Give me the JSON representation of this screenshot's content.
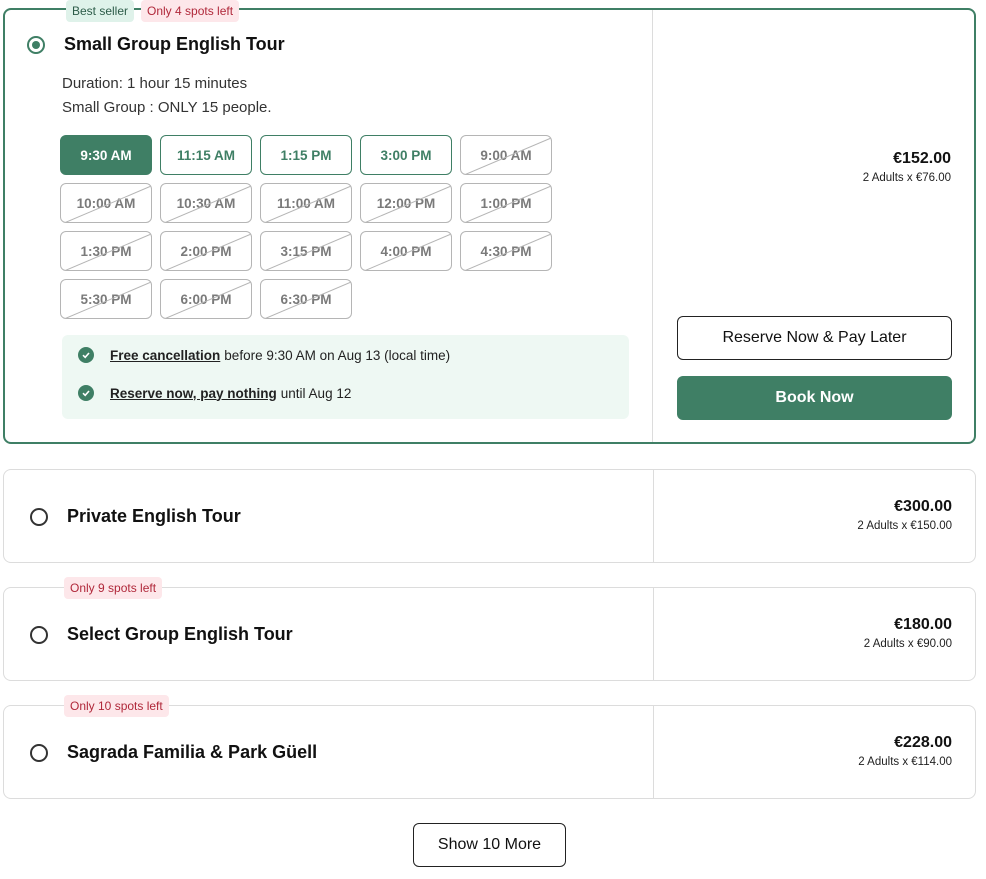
{
  "options": [
    {
      "badges": [
        "Best seller",
        "Only 4 spots left"
      ],
      "title": "Small Group English Tour",
      "duration": "Duration: 1 hour 15 minutes",
      "group": "Small Group : ONLY 15 people.",
      "selected": true,
      "slots": [
        {
          "time": "9:30 AM",
          "state": "selected"
        },
        {
          "time": "11:15 AM",
          "state": "available"
        },
        {
          "time": "1:15 PM",
          "state": "available"
        },
        {
          "time": "3:00 PM",
          "state": "available"
        },
        {
          "time": "9:00 AM",
          "state": "unavailable"
        },
        {
          "time": "10:00 AM",
          "state": "unavailable"
        },
        {
          "time": "10:30 AM",
          "state": "unavailable"
        },
        {
          "time": "11:00 AM",
          "state": "unavailable"
        },
        {
          "time": "12:00 PM",
          "state": "unavailable"
        },
        {
          "time": "1:00 PM",
          "state": "unavailable"
        },
        {
          "time": "1:30 PM",
          "state": "unavailable"
        },
        {
          "time": "2:00 PM",
          "state": "unavailable"
        },
        {
          "time": "3:15 PM",
          "state": "unavailable"
        },
        {
          "time": "4:00 PM",
          "state": "unavailable"
        },
        {
          "time": "4:30 PM",
          "state": "unavailable"
        },
        {
          "time": "5:30 PM",
          "state": "unavailable"
        },
        {
          "time": "6:00 PM",
          "state": "unavailable"
        },
        {
          "time": "6:30 PM",
          "state": "unavailable"
        }
      ],
      "cancellation": {
        "link": "Free cancellation",
        "text": "before 9:30 AM on Aug 13 (local time)"
      },
      "reserve": {
        "link": "Reserve now, pay nothing",
        "text": "until Aug 12"
      },
      "price": "€152.00",
      "breakdown": "2 Adults x €76.00",
      "reserve_button": "Reserve Now & Pay Later",
      "book_button": "Book Now"
    },
    {
      "title": "Private English Tour",
      "selected": false,
      "price": "€300.00",
      "breakdown": "2 Adults x €150.00"
    },
    {
      "badge": "Only 9 spots left",
      "title": "Select Group English Tour",
      "selected": false,
      "price": "€180.00",
      "breakdown": "2 Adults x €90.00"
    },
    {
      "badge": "Only 10 spots left",
      "title": "Sagrada Familia & Park Güell",
      "selected": false,
      "price": "€228.00",
      "breakdown": "2 Adults x €114.00"
    }
  ],
  "show_more": "Show 10 More",
  "colors": {
    "accent": "#3f7f65",
    "badge_spots": "#b0283a",
    "badge_seller_bg": "#dff2ea"
  },
  "icons": [
    "radio-selected-icon",
    "radio-empty-icon",
    "check-circle-icon"
  ]
}
